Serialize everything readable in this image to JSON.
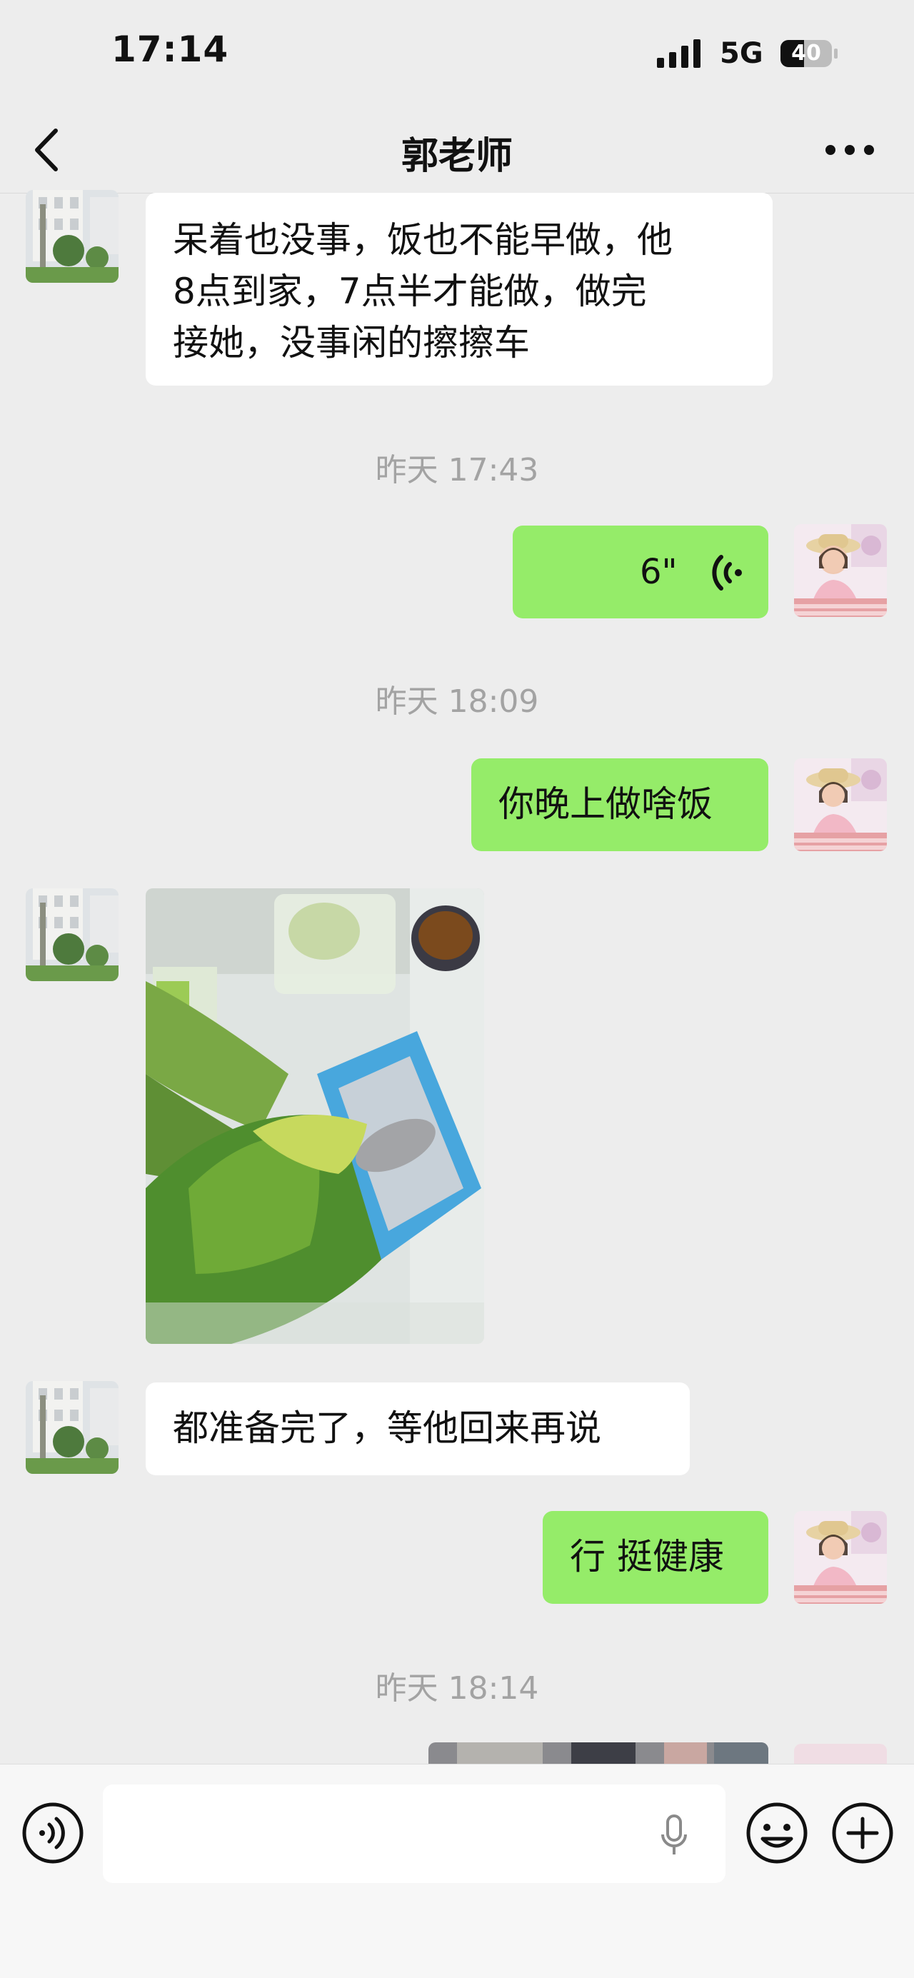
{
  "status_bar": {
    "time": "17:14",
    "network": "5G",
    "battery": "40"
  },
  "nav": {
    "title": "郭老师"
  },
  "messages": [
    {
      "type": "text",
      "side": "in",
      "text_lines": [
        "呆着也没事，饭也不能早做，他",
        "8点到家，7点半才能做，做完",
        "接她，没事闲的擦擦车"
      ]
    },
    {
      "type": "timestamp",
      "text": "昨天 17:43"
    },
    {
      "type": "voice",
      "side": "out",
      "duration": "6\""
    },
    {
      "type": "timestamp",
      "text": "昨天 18:09"
    },
    {
      "type": "text",
      "side": "out",
      "text": "你晚上做啥饭"
    },
    {
      "type": "image",
      "side": "in",
      "icon": "vegetables-photo"
    },
    {
      "type": "text",
      "side": "in",
      "text": "都准备完了，等他回来再说"
    },
    {
      "type": "text",
      "side": "out",
      "text": "行 挺健康"
    },
    {
      "type": "timestamp",
      "text": "昨天 18:14"
    },
    {
      "type": "image",
      "side": "out",
      "icon": "photo-partial"
    }
  ],
  "colors": {
    "background": "#ededed",
    "bubble_out": "#95ec69",
    "bubble_in": "#ffffff",
    "timestamp": "#a3a3a3"
  },
  "input_bar": {
    "icons": [
      "voice-input-icon",
      "microphone-icon",
      "emoji-icon",
      "plus-icon"
    ]
  }
}
